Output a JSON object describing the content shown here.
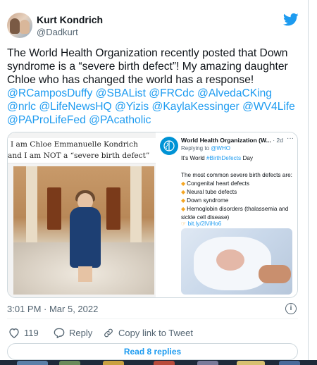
{
  "author": {
    "name": "Kurt Kondrich",
    "handle": "@Dadkurt"
  },
  "tweet": {
    "text_before": "The World Health Organization recently posted that Down syndrome is a “severe birth defect”! My amazing daughter Chloe who has changed the world has a response!",
    "mentions": [
      "@RCamposDuffy",
      "@SBAList",
      "@FRCdc",
      "@AlvedaCKing",
      "@nrlc",
      "@LifeNewsHQ",
      "@Yizis",
      "@KaylaKessinger",
      "@WV4Life",
      "@PAProLifeFed",
      "@PAcatholic"
    ]
  },
  "media": {
    "left_caption_line1": "I am Chloe Emmanuelle Kondrich",
    "left_caption_line2": "and I am NOT a “severe birth defect”",
    "who_name": "World Health Organization (W...",
    "who_date": "· 2d",
    "who_more": "···",
    "who_logo_text": "World Health Organization",
    "who_replying_prefix": "Replying to",
    "who_replying_handle": "@WHO",
    "who_day_prefix": "It's World",
    "who_day_hashtag": "#BirthDefects",
    "who_day_suffix": "Day",
    "who_intro": "The most common severe birth defects are:",
    "who_items": [
      "Congenital heart defects",
      "Neural tube defects",
      "Down syndrome",
      "Hemoglobin disorders (thalassemia and",
      "sickle cell disease)"
    ],
    "who_link": "bit.ly/2lViHo6"
  },
  "meta": {
    "timestamp": "3:01 PM · Mar 5, 2022",
    "info_icon": "info-icon"
  },
  "actions": {
    "like_count": "119",
    "reply_label": "Reply",
    "copy_label": "Copy link to Tweet",
    "read_replies_label": "Read 8 replies"
  },
  "colors": {
    "accent": "#1d9bf0",
    "text": "#0f1419",
    "muted": "#536471",
    "who_blue": "#0093d5"
  }
}
